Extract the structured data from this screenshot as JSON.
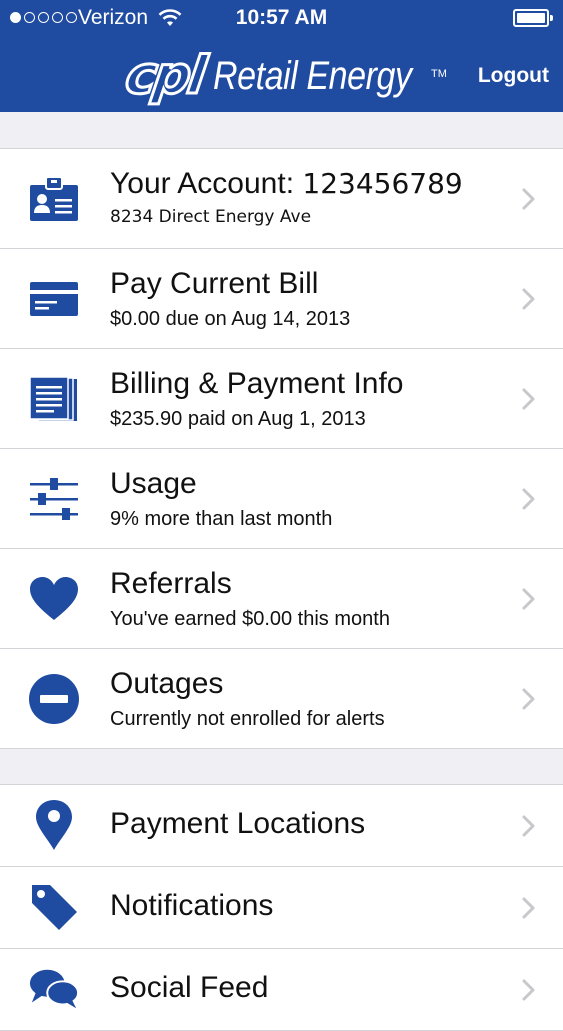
{
  "status_bar": {
    "carrier": "Verizon",
    "time": "10:57 AM",
    "signal_bars_filled": 1,
    "signal_bars_total": 5
  },
  "header": {
    "logo_mark": "cpl",
    "logo_text": "Retail Energy",
    "logo_tm": "TM",
    "logout_label": "Logout",
    "background_color": "#1f4ba1"
  },
  "main_menu": [
    {
      "icon": "id-badge-icon",
      "title": "Your Account:",
      "account_number": "123456789",
      "subtitle": "8234 Direct Energy Ave"
    },
    {
      "icon": "credit-card-icon",
      "title": "Pay Current Bill",
      "subtitle": "$0.00 due on Aug 14, 2013"
    },
    {
      "icon": "document-stack-icon",
      "title": "Billing & Payment Info",
      "subtitle": "$235.90 paid on Aug 1, 2013"
    },
    {
      "icon": "sliders-icon",
      "title": "Usage",
      "subtitle": "9% more than last month"
    },
    {
      "icon": "heart-icon",
      "title": "Referrals",
      "subtitle": "You've earned $0.00 this month"
    },
    {
      "icon": "minus-circle-icon",
      "title": "Outages",
      "subtitle": "Currently not enrolled for alerts"
    }
  ],
  "secondary_menu": [
    {
      "icon": "map-pin-icon",
      "title": "Payment Locations"
    },
    {
      "icon": "tag-icon",
      "title": "Notifications"
    },
    {
      "icon": "speech-bubbles-icon",
      "title": "Social Feed"
    }
  ],
  "accent_color": "#1f4ba1"
}
